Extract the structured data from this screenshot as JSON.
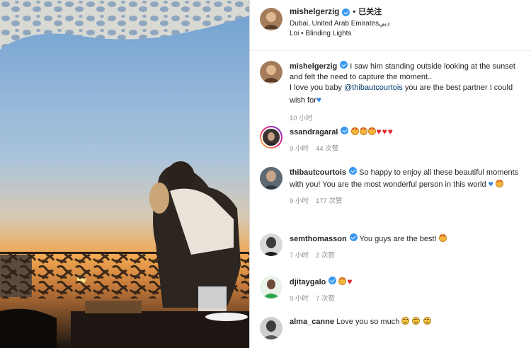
{
  "post": {
    "author": "mishelgerzig",
    "follow_label": "已关注",
    "location": "Dubai, United Arab Emiratesدبي",
    "music": "Loi • Blinding Lights",
    "caption_user": "mishelgerzig",
    "caption_part1": " I saw him standing outside looking at the sunset and felt the need to capture the moment..",
    "caption_part2": "I love you baby ",
    "caption_mention": "@thibautcourtois",
    "caption_part3": " you are the best partner I could wish for",
    "caption_time": "10 小时"
  },
  "colors": {
    "verified": "#3897f0",
    "mention": "#00376b",
    "meta": "#8e8e8e"
  },
  "comments": [
    {
      "user": "ssandragaral",
      "text": "",
      "emojis": [
        "heart-eyes",
        "heart-eyes",
        "heart-eyes",
        "red-heart",
        "red-heart",
        "red-heart"
      ],
      "time": "9 小时",
      "likes": "44 次赞"
    },
    {
      "user": "thibautcourtois",
      "text": " So happy to enjoy all these beautiful moments with you! You are the most wonderful person in this world ",
      "emojis": [
        "blue-heart",
        "heart-eyes"
      ],
      "time": "9 小时",
      "likes": "177 次赞"
    },
    {
      "user": "semthomasson",
      "text": " You guys are the best! ",
      "emojis": [
        "heart-eyes"
      ],
      "time": "7 小时",
      "likes": "2 次赞"
    },
    {
      "user": "djitaygalo",
      "text": " ",
      "emojis": [
        "heart-eyes",
        "red-heart"
      ],
      "time": "9 小时",
      "likes": "7 次赞"
    },
    {
      "user": "alma_canne",
      "text": " Love you so much ",
      "emojis": [
        "smile",
        "smile",
        "smile"
      ],
      "time": "",
      "likes": ""
    }
  ]
}
